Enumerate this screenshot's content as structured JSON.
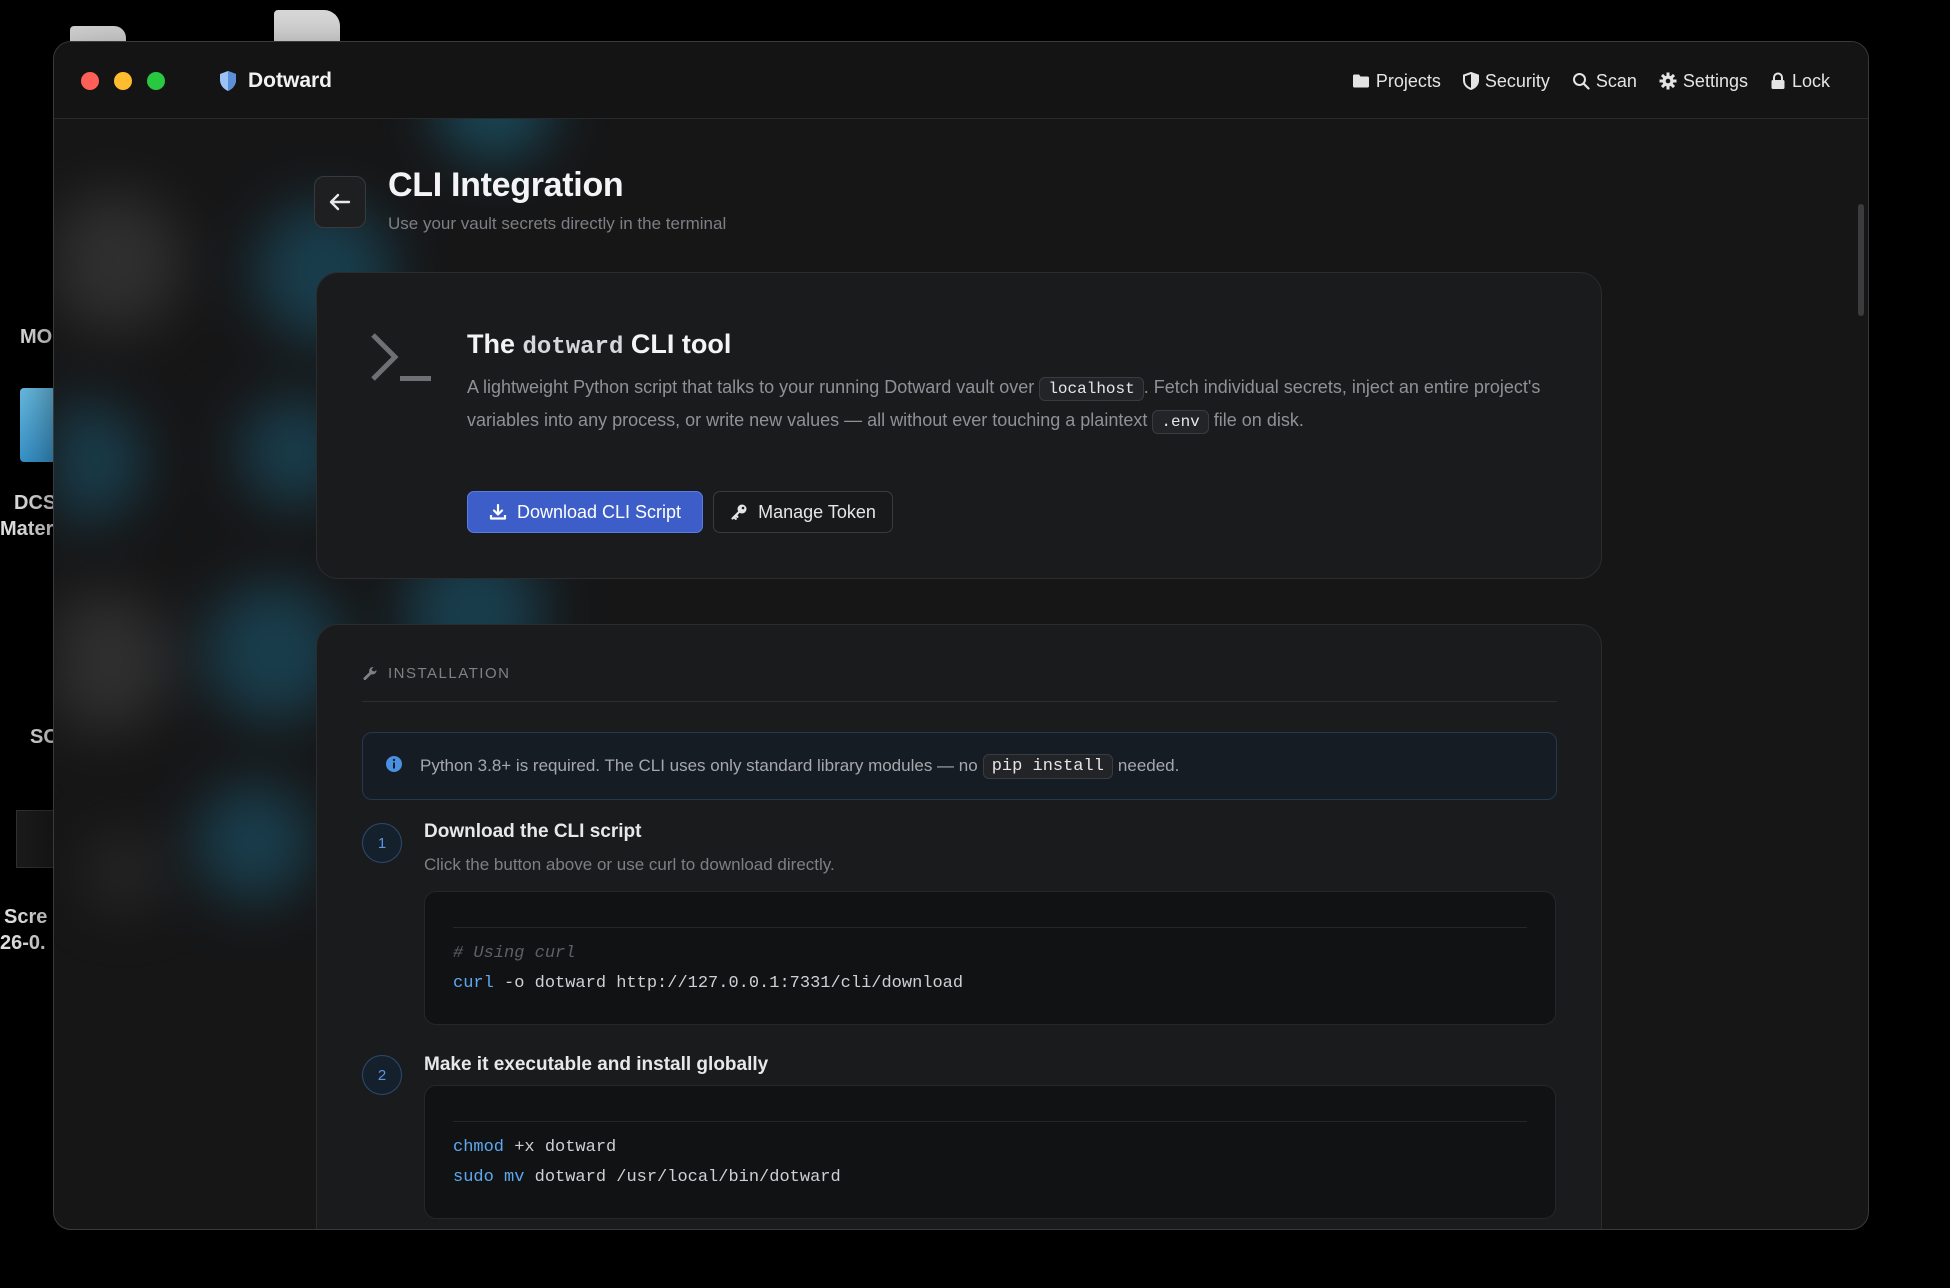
{
  "desktop": {
    "labels": [
      "MO",
      "DCS",
      "Materi",
      "SC",
      "Scre",
      "26-0."
    ]
  },
  "app": {
    "name": "Dotward",
    "nav": [
      {
        "label": "Projects",
        "icon": "folder-icon"
      },
      {
        "label": "Security",
        "icon": "shield-icon"
      },
      {
        "label": "Scan",
        "icon": "search-icon"
      },
      {
        "label": "Settings",
        "icon": "gear-icon"
      },
      {
        "label": "Lock",
        "icon": "lock-icon"
      }
    ]
  },
  "page": {
    "title": "CLI Integration",
    "subtitle": "Use your vault secrets directly in the terminal"
  },
  "tool_card": {
    "title_prefix": "The",
    "title_code": "dotward",
    "title_suffix": "CLI tool",
    "desc_1": "A lightweight Python script that talks to your running Dotward vault over",
    "desc_code_1": "localhost",
    "desc_2": ". Fetch individual secrets, inject an entire project's variables into any process, or write new values — all without ever touching a plaintext",
    "desc_code_2": ".env",
    "desc_3": "file on disk.",
    "download_label": "Download CLI Script",
    "manage_label": "Manage Token"
  },
  "installation": {
    "heading": "INSTALLATION",
    "info_1": "Python 3.8+ is required. The CLI uses only standard library modules — no",
    "info_code": "pip install",
    "info_2": "needed.",
    "steps": [
      {
        "num": "1",
        "title": "Download the CLI script",
        "desc": "Click the button above or use curl to download directly.",
        "comment": "# Using curl",
        "cmd": "curl",
        "args": " -o dotward http://127.0.0.1:7331/cli/download"
      },
      {
        "num": "2",
        "title": "Make it executable and install globally",
        "line1_cmd": "chmod",
        "line1_args": " +x dotward",
        "line2_cmd": "sudo mv",
        "line2_args": " dotward /usr/local/bin/dotward"
      }
    ]
  },
  "colors": {
    "accent": "#3d5ec9",
    "window_bg": "#161617",
    "card_bg": "#1a1b1d",
    "info_blue": "#4a90e2",
    "traffic_red": "#ff5f57",
    "traffic_yellow": "#febc2e",
    "traffic_green": "#28c840"
  }
}
